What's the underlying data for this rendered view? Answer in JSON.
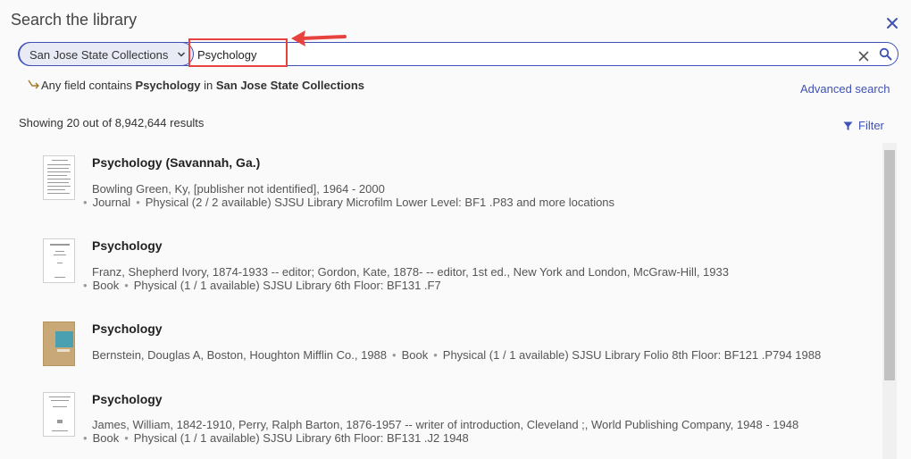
{
  "header": {
    "title": "Search the library"
  },
  "search": {
    "scope_label": "San Jose State Collections",
    "query": "Psychology"
  },
  "summary": {
    "prefix": "Any field contains",
    "term": "Psychology",
    "in": "in",
    "scope": "San Jose State Collections"
  },
  "links": {
    "advanced_search": "Advanced search",
    "filter": "Filter"
  },
  "results_info": "Showing 20 out of 8,942,644 results",
  "colors": {
    "accent": "#3f51b5",
    "highlight": "#e8423f"
  },
  "results": [
    {
      "title": "Psychology (Savannah, Ga.)",
      "line1": "Bowling Green, Ky, [publisher not identified], 1964 - 2000",
      "type": "Journal",
      "availability": "Physical (2 / 2 available) SJSU Library Microfilm Lower Level: BF1 .P83 and more locations"
    },
    {
      "title": "Psychology",
      "line1": "Franz, Shepherd Ivory, 1874-1933 -- editor; Gordon, Kate, 1878- -- editor, 1st ed., New York and London, McGraw-Hill, 1933",
      "type": "Book",
      "availability": "Physical (1 / 1 available) SJSU Library 6th Floor: BF131 .F7"
    },
    {
      "title": "Psychology",
      "line1": "Bernstein, Douglas A, Boston, Houghton Mifflin Co., 1988",
      "type": "Book",
      "availability": "Physical (1 / 1 available) SJSU Library Folio 8th Floor: BF121 .P794 1988"
    },
    {
      "title": "Psychology",
      "line1": "James, William, 1842-1910, Perry, Ralph Barton, 1876-1957 -- writer of introduction, Cleveland ;, World Publishing Company, 1948 - 1948",
      "type": "Book",
      "availability": "Physical (1 / 1 available) SJSU Library 6th Floor: BF131 .J2 1948"
    }
  ]
}
